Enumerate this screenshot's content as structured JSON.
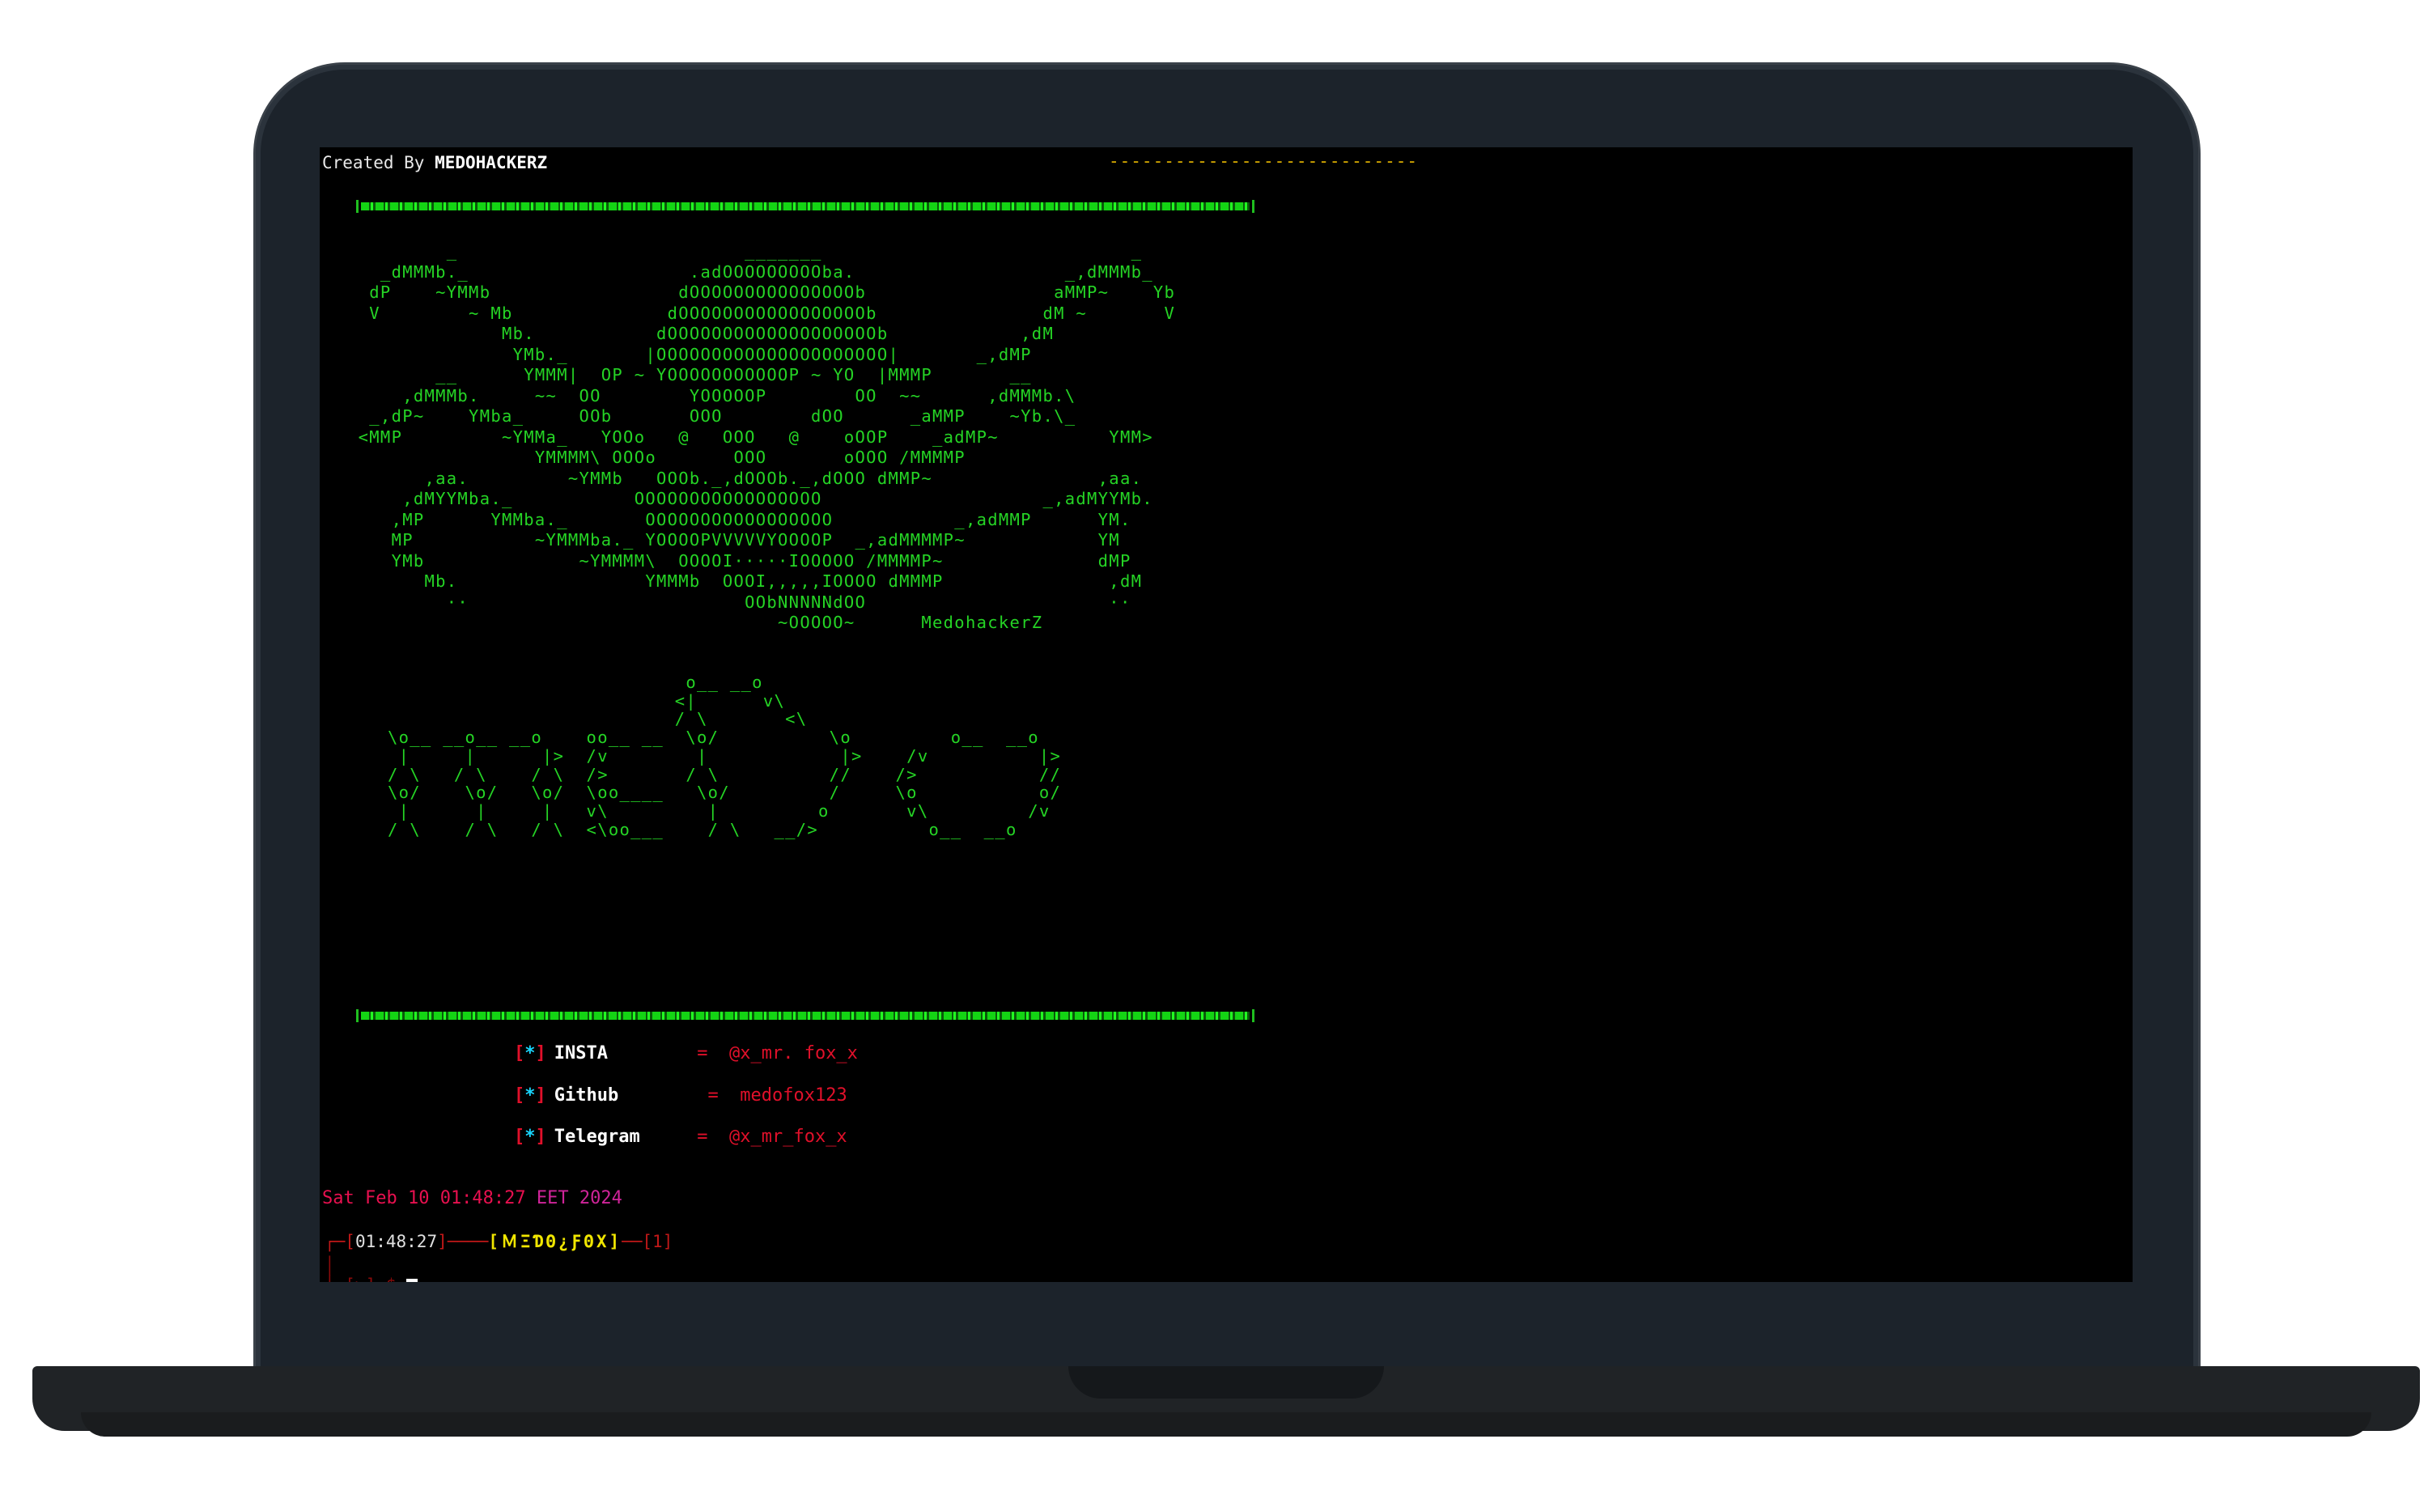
{
  "header": {
    "created_prefix": "Created By ",
    "created_author": "MEDOHACKERZ",
    "dashes": "----------------------------"
  },
  "ascii_art": "         _                          _______                            _\n   _dMMMb._                    .adOOOOOOOOOba.                   _,dMMMb_\n  dP    ~YMMb                 dOOOOOOOOOOOOOOOb                 aMMP~    Yb\n  V        ~ Mb              dOOOOOOOOOOOOOOOOOb               dM ~       V\n              Mb.           dOOOOOOOOOOOOOOOOOOOb            ,dM\n               YMb._       |OOOOOOOOOOOOOOOOOOOOO|       _,dMP\n        __      YMMM|  OP ~ YOOOOOOOOOOOP ~ YO  |MMMP       __\n     ,dMMMb.     ~~  OO        YOOOOOP        OO  ~~      ,dMMMb.\\\n  _,dP~    YMba_     OOb       OOO        dOO      _aMMP    ~Yb.\\_\n <MMP         ~YMMa_   YOOo   @   OOO   @    oOOP    _adMP~          YMM>\n                 YMMMM\\ OOOo       OOO       oOOO /MMMMP\n       ,aa.         ~YMMb   OOOb._,dOOOb._,dOOO dMMP~               ,aa.\n     ,dMYYMba._           OOOOOOOOOOOOOOOOO                    _,adMYYMb.\n    ,MP      YMMba._       OOOOOOOOOOOOOOOOO           _,adMMP      YM.\n    MP           ~YMMMba._ YOOOOPVVVVVYOOOOP  _,adMMMMP~            YM\n    YMb              ~YMMMM\\  OOOOI·····IOOOOO /MMMMP~              dMP\n       Mb.                 YMMMb  OOOI,,,,,IOOOO dMMMP               ,dM\n         ··                         OObNNNNNdOO                      ··\n                                       ~OOOOO~      MedohackerZ",
  "ascii_logo": "                           o__ __o\n                          <|      v\\\n                          / \\       <\\\n\\o__ __o__ __o    oo__ __  \\o/          \\o         o__  __o\n |     |      |>  /v        |            |>    /v          |>\n/ \\   / \\    / \\  />       / \\          //    />           //\n\\o/    \\o/   \\o/  \\oo____   \\o/         /     \\o           o/\n |      |     |   v\\         |         o       v\\         /v\n/ \\    / \\   / \\  <\\oo___    / \\   __/>          o__  __o",
  "contacts": [
    {
      "label": "INSTA",
      "eq": "  =  ",
      "value": "@x_mr. fox_x"
    },
    {
      "label": "Github",
      "eq": "   =  ",
      "value": "medofox123"
    },
    {
      "label": "Telegram",
      "eq": "  =  ",
      "value": "@x_mr_fox_x"
    }
  ],
  "bracket_open": "[",
  "bracket_star": "*",
  "bracket_close": "]",
  "date": {
    "part1": "Sat Feb 10 01:48:27 ",
    "part2": "EET 2024"
  },
  "prompt": {
    "prefix": "┌─[",
    "time": "01:48:27",
    "mid": "]────",
    "name": "[ＭΞƊΘ¿ƑΘΧ]",
    "sep": "──[",
    "num": "1",
    "end": "]",
    "line2": "│\n└─[>]",
    "cmd": "~$ "
  },
  "colors": {
    "ascii_green": "#25d425",
    "error_red": "#e0102a",
    "accent_cyan": "#19d6ff",
    "prompt_yellow": "#f0e600",
    "date_pink": "#e8104f",
    "date_magenta": "#d0249a",
    "header_dashes_yellow": "#e0b000"
  }
}
